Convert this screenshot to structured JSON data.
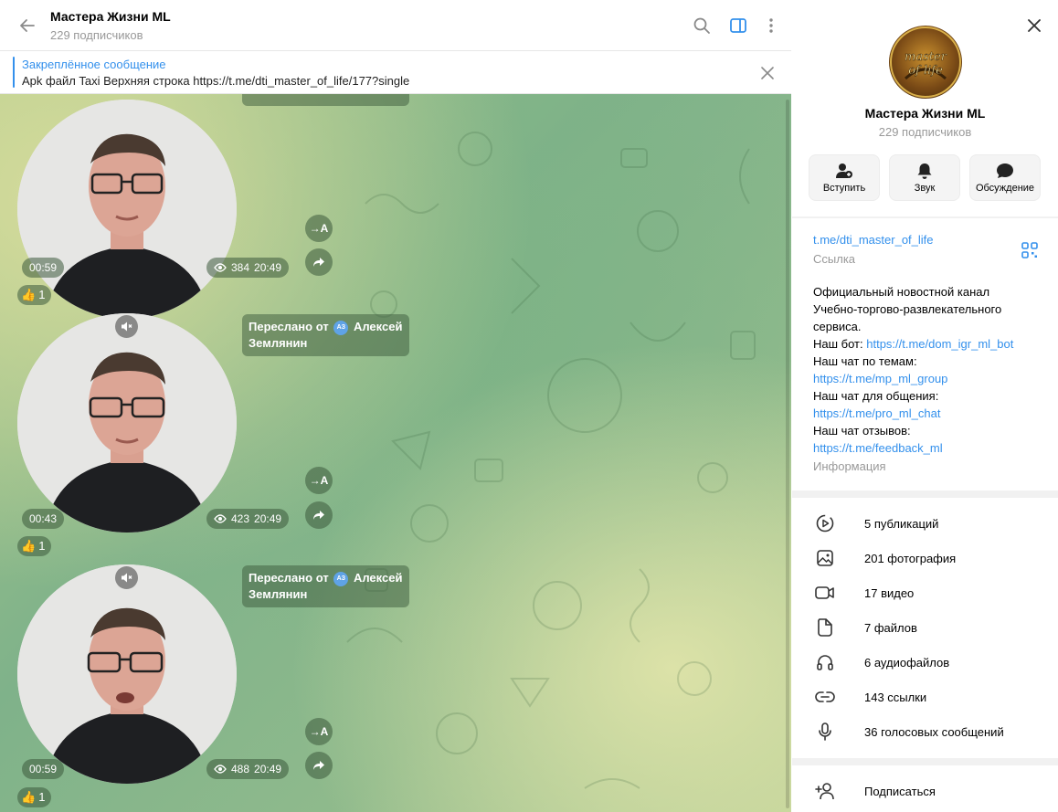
{
  "chat": {
    "title": "Мастера Жизни ML",
    "subtitle": "229 подписчиков"
  },
  "pinned": {
    "title": "Закреплённое сообщение",
    "text": "Apk файл Taxi  Верхняя строка  https://t.me/dti_master_of_life/177?single"
  },
  "messages": [
    {
      "duration": "00:59",
      "views": "384",
      "time": "20:49",
      "reaction_emoji": "👍",
      "reaction_count": "1",
      "forward_prefix": "",
      "forward_initials": "",
      "forward_name": ""
    },
    {
      "duration": "00:43",
      "views": "423",
      "time": "20:49",
      "reaction_emoji": "👍",
      "reaction_count": "1",
      "forward_prefix": "Переслано от",
      "forward_initials": "АЗ",
      "forward_name": "Алексей Землянин"
    },
    {
      "duration": "00:59",
      "views": "488",
      "time": "20:49",
      "reaction_emoji": "👍",
      "reaction_count": "1",
      "forward_prefix": "Переслано от",
      "forward_initials": "АЗ",
      "forward_name": "Алексей Землянин"
    }
  ],
  "translate_label": "→A",
  "info": {
    "name": "Мастера Жизни ML",
    "subs": "229 подписчиков",
    "avatar_text": "master of life",
    "actions": {
      "join": "Вступить",
      "sound": "Звук",
      "discussion": "Обсуждение"
    },
    "link": "t.me/dti_master_of_life",
    "link_label": "Ссылка",
    "desc_lines": {
      "l1": "Официальный новостной канал",
      "l2": "Учебно-торгово-развлекательного",
      "l3": "сервиса.",
      "bot_prefix": "Наш бот: ",
      "bot_link": "https://t.me/dom_igr_ml_bot",
      "themes": "Наш чат по темам:",
      "themes_link": "https://t.me/mp_ml_group",
      "talk": "Наш чат для общения:",
      "talk_link": "https://t.me/pro_ml_chat",
      "reviews": "Наш чат отзывов:",
      "reviews_link": "https://t.me/feedback_ml"
    },
    "desc_label": "Информация",
    "media": {
      "posts": "5 публикаций",
      "photos": "201 фотография",
      "videos": "17 видео",
      "files": "7 файлов",
      "audio": "6 аудиофайлов",
      "links": "143 ссылки",
      "voice": "36 голосовых сообщений"
    },
    "subscribe": "Подписаться"
  },
  "colors": {
    "accent": "#3390ec",
    "bubble": "#3c5a3c"
  }
}
